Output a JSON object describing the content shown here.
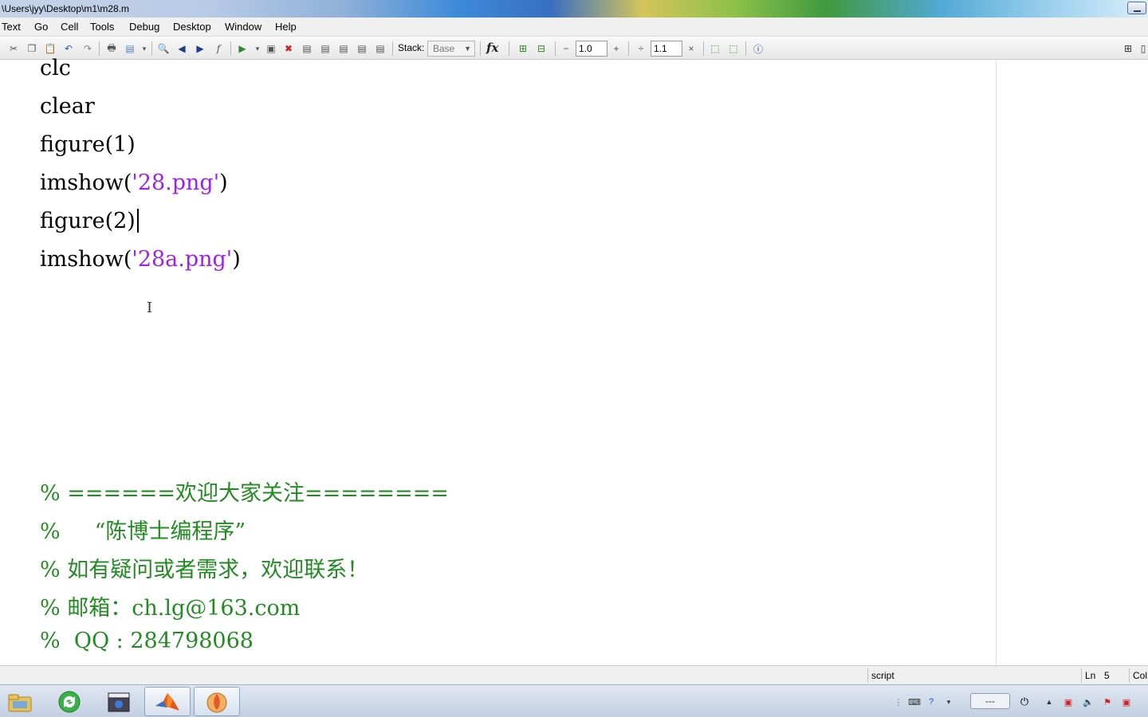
{
  "window": {
    "title": "\\Users\\jyy\\Desktop\\m1\\m28.m"
  },
  "menu": [
    "Text",
    "Go",
    "Cell",
    "Tools",
    "Debug",
    "Desktop",
    "Window",
    "Help"
  ],
  "toolbar": {
    "stack_label": "Stack:",
    "stack_value": "Base",
    "fx_label": "fx",
    "minus_label": "−",
    "cell_value_1": "1.0",
    "plus_label": "+",
    "divide_label": "÷",
    "cell_value_2": "1.1",
    "times_label": "×"
  },
  "editor": {
    "lines": {
      "l1": "clc",
      "l2": "clear",
      "l3": "figure(1)",
      "l4_pre": "imshow(",
      "l4_str": "'28.png'",
      "l4_post": ")",
      "l5": "figure(2)",
      "l6_pre": "imshow(",
      "l6_str": "'28a.png'",
      "l6_post": ")",
      "c1": "% ======欢迎大家关注========",
      "c2": "%     “陈博士编程序”",
      "c3": "% 如有疑问或者需求，欢迎联系！",
      "c4": "% 邮箱：ch.lg@163.com",
      "c5": "%  QQ : 284798068"
    },
    "cursor_line": 5
  },
  "status": {
    "mode": "script",
    "ln_label": "Ln",
    "ln_value": "5",
    "col_label": "Col"
  },
  "taskbar": {
    "clock": "---"
  },
  "colors": {
    "string": "#a020f0",
    "comment": "#228b22",
    "code": "#000000"
  }
}
